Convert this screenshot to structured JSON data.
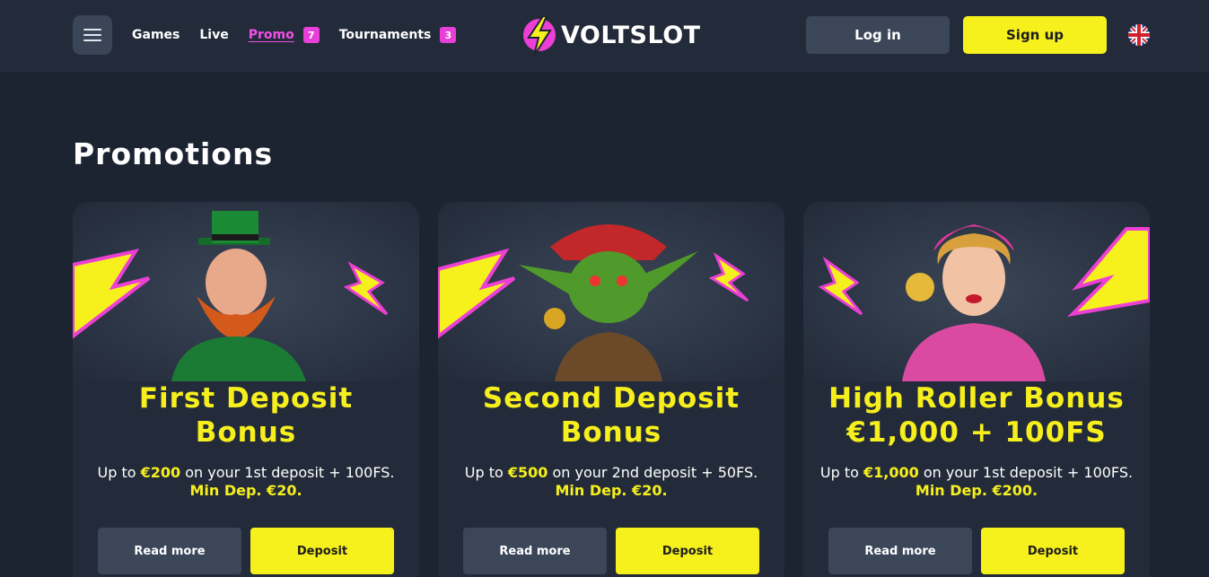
{
  "nav": {
    "items": [
      {
        "label": "Games",
        "badge": null
      },
      {
        "label": "Live",
        "badge": null
      },
      {
        "label": "Promo",
        "badge": "7"
      },
      {
        "label": "Tournaments",
        "badge": "3"
      }
    ]
  },
  "logo": {
    "text": "VOLTSLOT"
  },
  "auth": {
    "login_label": "Log in",
    "signup_label": "Sign up"
  },
  "language": {
    "icon": "uk-flag-icon"
  },
  "page": {
    "title": "Promotions"
  },
  "promos": [
    {
      "title_line1": "First Deposit",
      "title_line2": "Bonus",
      "desc_prefix": "Up to ",
      "desc_amount": "€200",
      "desc_suffix": " on your 1st deposit + 100FS.",
      "min_dep": "Min Dep. €20.",
      "read_more_label": "Read more",
      "deposit_label": "Deposit",
      "art": "leprechaun-illustration"
    },
    {
      "title_line1": "Second Deposit",
      "title_line2": "Bonus",
      "desc_prefix": "Up to ",
      "desc_amount": "€500",
      "desc_suffix": " on your 2nd deposit + 50FS.",
      "min_dep": "Min Dep. €20.",
      "read_more_label": "Read more",
      "deposit_label": "Deposit",
      "art": "goblin-pirate-illustration"
    },
    {
      "title_line1": "High Roller Bonus",
      "title_line2": "€1,000 + 100FS",
      "desc_prefix": "Up to ",
      "desc_amount": "€1,000",
      "desc_suffix": " on your 1st deposit + 100FS.",
      "min_dep": "Min Dep. €200.",
      "read_more_label": "Read more",
      "deposit_label": "Deposit",
      "art": "pinup-woman-illustration"
    }
  ],
  "colors": {
    "background": "#1c2331",
    "header": "#232b3a",
    "accent_yellow": "#f6f01d",
    "accent_pink": "#ec3fd4",
    "button_dark": "#3b4659"
  }
}
